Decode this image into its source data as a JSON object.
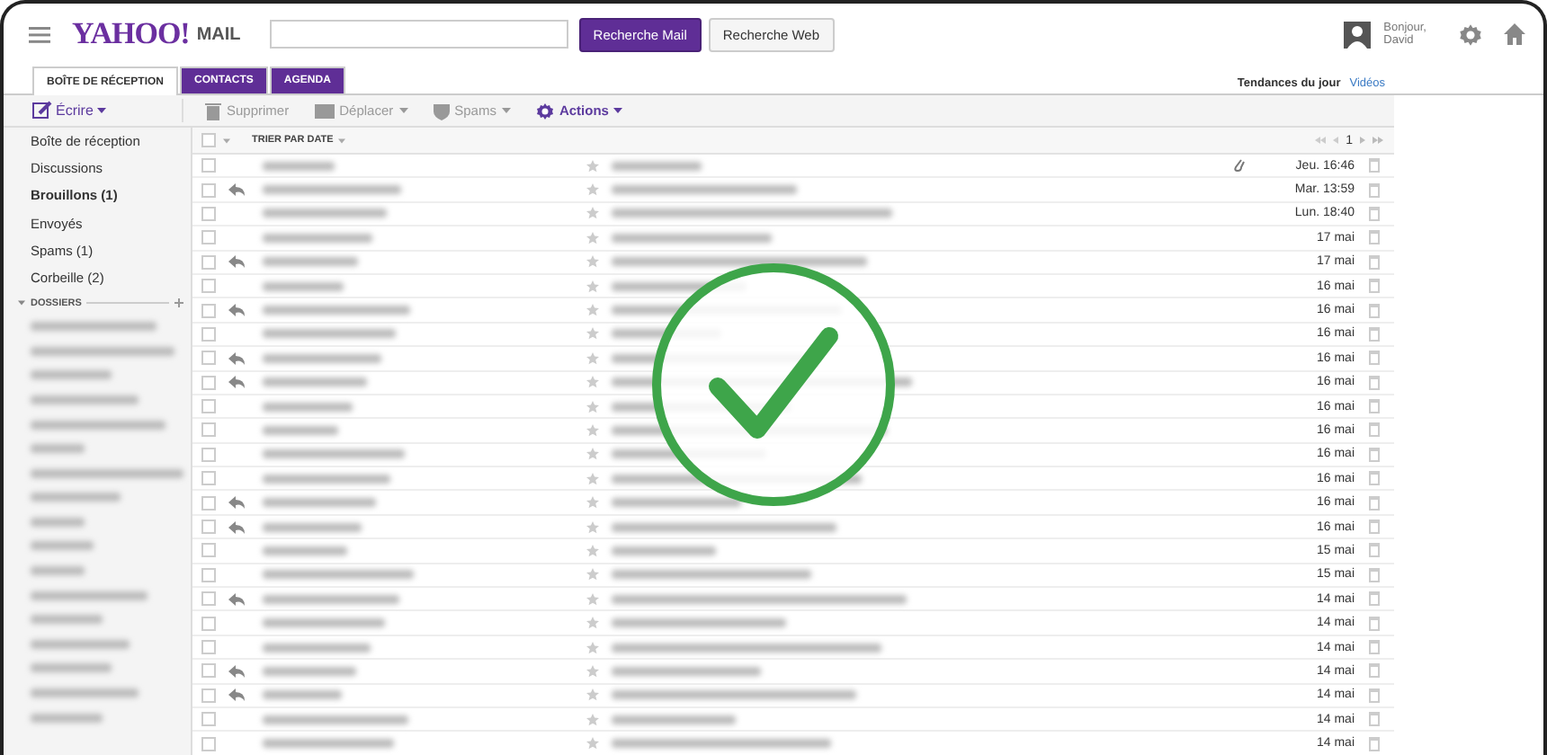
{
  "header": {
    "logo": "YAHOO!",
    "logo_suffix": "MAIL",
    "buttons": [
      {
        "label": "Recherche Mail",
        "kind": "primary"
      },
      {
        "label": "Recherche Web",
        "kind": "secondary"
      }
    ],
    "greeting": "Bonjour,",
    "user": "David"
  },
  "tabs": [
    {
      "label": "BOÎTE DE RÉCEPTION",
      "selected": true
    },
    {
      "label": "CONTACTS",
      "selected": false
    },
    {
      "label": "AGENDA",
      "selected": false
    }
  ],
  "trending": {
    "label": "Tendances du jour",
    "link": "Vidéos"
  },
  "compose": "Écrire",
  "toolbar": [
    {
      "label": "Supprimer",
      "kind": "trash",
      "disabled": true,
      "dropdown": false
    },
    {
      "label": "Déplacer",
      "kind": "folder",
      "disabled": true,
      "dropdown": true
    },
    {
      "label": "Spams",
      "kind": "shield",
      "disabled": true,
      "dropdown": true
    },
    {
      "label": "Actions",
      "kind": "gear",
      "disabled": false,
      "dropdown": true
    }
  ],
  "sidebar": {
    "items": [
      {
        "label": "Boîte de réception",
        "bold": false
      },
      {
        "label": "Discussions",
        "bold": false
      },
      {
        "label": "Brouillons (1)",
        "bold": true
      },
      {
        "label": "Envoyés",
        "bold": false
      },
      {
        "label": "Spams (1)",
        "bold": false
      },
      {
        "label": "Corbeille (2)",
        "bold": false
      }
    ],
    "folders_heading": "DOSSIERS"
  },
  "list": {
    "sort_label": "TRIER PAR DATE",
    "page": "1",
    "select_all_checked": false
  },
  "rows": [
    {
      "date": "Jeu. 16:46",
      "replied": false,
      "attachment": true,
      "checked": false
    },
    {
      "date": "Mar. 13:59",
      "replied": true,
      "attachment": false,
      "checked": false
    },
    {
      "date": "Lun. 18:40",
      "replied": false,
      "attachment": false,
      "checked": false
    },
    {
      "date": "17 mai",
      "replied": false,
      "attachment": false,
      "checked": false
    },
    {
      "date": "17 mai",
      "replied": true,
      "attachment": false,
      "checked": false
    },
    {
      "date": "16 mai",
      "replied": false,
      "attachment": false,
      "checked": false
    },
    {
      "date": "16 mai",
      "replied": true,
      "attachment": false,
      "checked": false
    },
    {
      "date": "16 mai",
      "replied": false,
      "attachment": false,
      "checked": false
    },
    {
      "date": "16 mai",
      "replied": true,
      "attachment": false,
      "checked": false
    },
    {
      "date": "16 mai",
      "replied": true,
      "attachment": false,
      "checked": false
    },
    {
      "date": "16 mai",
      "replied": false,
      "attachment": false,
      "checked": false
    },
    {
      "date": "16 mai",
      "replied": false,
      "attachment": false,
      "checked": false
    },
    {
      "date": "16 mai",
      "replied": false,
      "attachment": false,
      "checked": false
    },
    {
      "date": "16 mai",
      "replied": false,
      "attachment": false,
      "checked": false
    },
    {
      "date": "16 mai",
      "replied": true,
      "attachment": false,
      "checked": false
    },
    {
      "date": "16 mai",
      "replied": true,
      "attachment": false,
      "checked": false
    },
    {
      "date": "15 mai",
      "replied": false,
      "attachment": false,
      "checked": false
    },
    {
      "date": "15 mai",
      "replied": false,
      "attachment": false,
      "checked": false
    },
    {
      "date": "14 mai",
      "replied": true,
      "attachment": false,
      "checked": false
    },
    {
      "date": "14 mai",
      "replied": false,
      "attachment": false,
      "checked": false
    },
    {
      "date": "14 mai",
      "replied": false,
      "attachment": false,
      "checked": false
    },
    {
      "date": "14 mai",
      "replied": true,
      "attachment": false,
      "checked": false
    },
    {
      "date": "14 mai",
      "replied": true,
      "attachment": false,
      "checked": false
    },
    {
      "date": "14 mai",
      "replied": false,
      "attachment": false,
      "checked": false
    },
    {
      "date": "14 mai",
      "replied": false,
      "attachment": false,
      "checked": false
    }
  ]
}
